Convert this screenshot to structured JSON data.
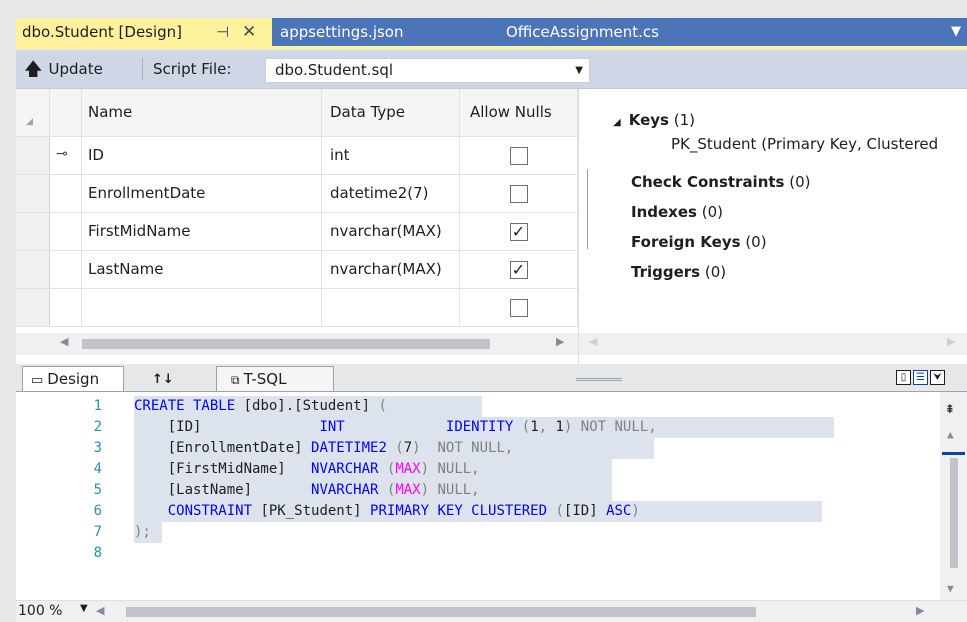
{
  "tabs": [
    {
      "label": "dbo.Student [Design]",
      "pin_glyph": "⊣",
      "close_glyph": "✕"
    },
    {
      "label": "appsettings.json"
    },
    {
      "label": "OfficeAssignment.cs"
    }
  ],
  "tab_dropdown_glyph": "▼",
  "toolbar": {
    "update_label": "Update",
    "update_icon": "up-arrow-icon",
    "script_label": "Script File:",
    "script_file": "dbo.Student.sql"
  },
  "grid": {
    "headers": {
      "name": "Name",
      "type": "Data Type",
      "nulls": "Allow Nulls"
    },
    "rows": [
      {
        "name": "ID",
        "type": "int",
        "allow_nulls": false,
        "key": true,
        "key_glyph": "⊸"
      },
      {
        "name": "EnrollmentDate",
        "type": "datetime2(7)",
        "allow_nulls": false
      },
      {
        "name": "FirstMidName",
        "type": "nvarchar(MAX)",
        "allow_nulls": true
      },
      {
        "name": "LastName",
        "type": "nvarchar(MAX)",
        "allow_nulls": true
      },
      {
        "name": "",
        "type": "",
        "allow_nulls": false
      }
    ]
  },
  "keys_panel": {
    "expander": "◢",
    "keys_label": "Keys",
    "keys_count": "(1)",
    "pk_label": "PK_Student   (Primary Key, Clustered",
    "check_label": "Check Constraints",
    "check_count": "(0)",
    "indexes_label": "Indexes",
    "indexes_count": "(0)",
    "fk_label": "Foreign Keys",
    "fk_count": "(0)",
    "triggers_label": "Triggers",
    "triggers_count": "(0)"
  },
  "pane_tabs": {
    "design_label": "Design",
    "swap_label": "↑↓",
    "tsql_label": "T-SQL"
  },
  "sql": {
    "lines": [
      "1",
      "2",
      "3",
      "4",
      "5",
      "6",
      "7",
      "8"
    ]
  },
  "status": {
    "zoom": "100 %"
  },
  "colors": {
    "active_tab": "#fff29d",
    "tab_strip": "#4c74b8",
    "keyword": "#0000ff",
    "function": "#ff00ff",
    "line_number": "#2b91af"
  }
}
